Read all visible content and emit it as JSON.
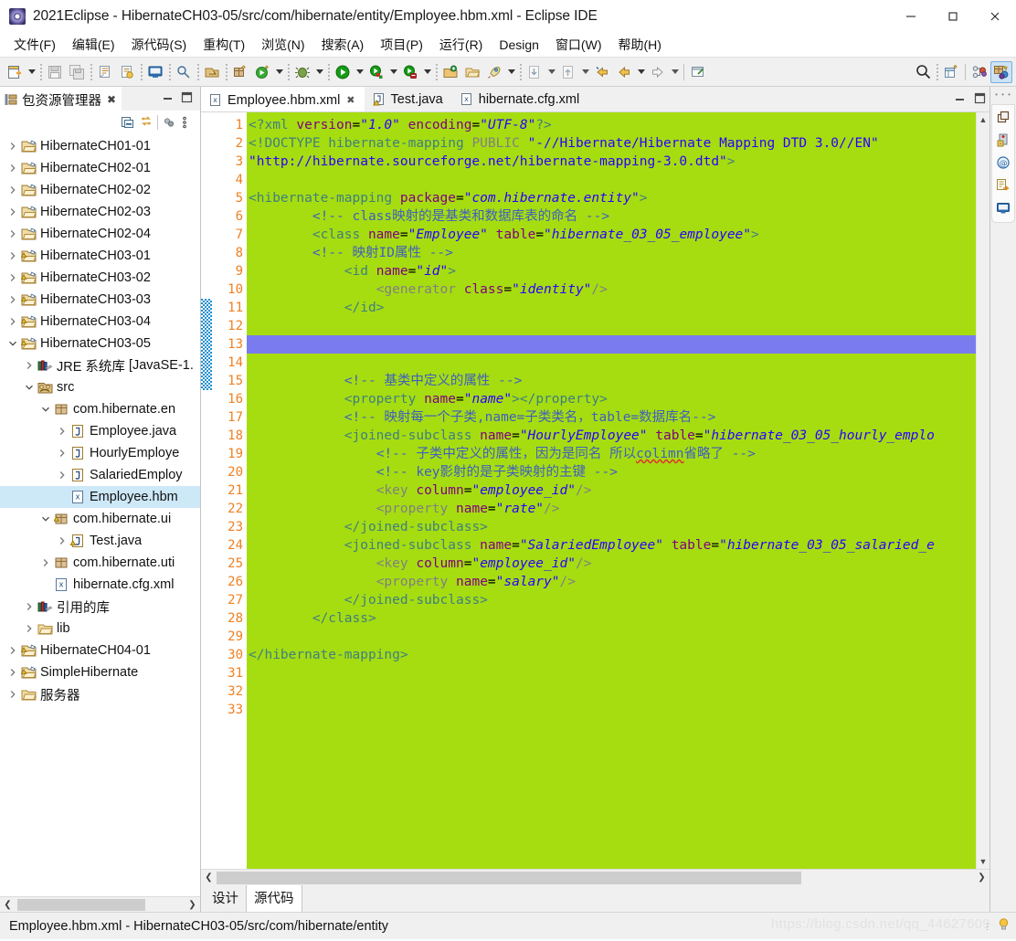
{
  "window": {
    "title": "2021Eclipse - HibernateCH03-05/src/com/hibernate/entity/Employee.hbm.xml - Eclipse IDE",
    "app_icon": "eclipse-icon",
    "minimize_label": "—",
    "maximize_label": "□",
    "close_label": "✕"
  },
  "menubar": {
    "items": [
      {
        "label": "文件(F)"
      },
      {
        "label": "编辑(E)"
      },
      {
        "label": "源代码(S)"
      },
      {
        "label": "重构(T)"
      },
      {
        "label": "浏览(N)"
      },
      {
        "label": "搜索(A)"
      },
      {
        "label": "项目(P)"
      },
      {
        "label": "运行(R)"
      },
      {
        "label": "Design"
      },
      {
        "label": "窗口(W)"
      },
      {
        "label": "帮助(H)"
      }
    ]
  },
  "toolbar": {
    "buttons": [
      "new-icon",
      "save-icon",
      "save-all-icon",
      "print-icon",
      "export-icon",
      "console-icon",
      "search-find-icon",
      "open-type-icon",
      "new-package-icon",
      "run-validate-icon",
      "debug-icon",
      "run-icon",
      "coverage-icon",
      "profile-icon",
      "open-perspective-icon",
      "open-folder-icon",
      "launch-icon",
      "next-annotation-icon",
      "previous-annotation-icon",
      "back-icon",
      "forward-icon",
      "forward-arrow-icon",
      "new-window-icon",
      "search-icon",
      "new-perspective-icon",
      "java-perspective-icon",
      "java-ee-perspective-icon"
    ]
  },
  "explorer": {
    "tab_title": "包资源管理器",
    "tab_icon": "package-explorer-icon",
    "close_icon": "close-icon",
    "view_buttons": [
      "collapse-all-icon",
      "link-with-editor-icon",
      "view-menu-icon",
      "view-menu-dots-icon"
    ],
    "minimize_icon": "minimize-icon",
    "maximize_icon": "maximize-icon",
    "tree": [
      {
        "label": "HibernateCH01-01",
        "icon": "project-icon",
        "indent": 0,
        "twisty": "collapsed",
        "selected": false
      },
      {
        "label": "HibernateCH02-01",
        "icon": "project-icon",
        "indent": 0,
        "twisty": "collapsed",
        "selected": false
      },
      {
        "label": "HibernateCH02-02",
        "icon": "project-icon",
        "indent": 0,
        "twisty": "collapsed",
        "selected": false
      },
      {
        "label": "HibernateCH02-03",
        "icon": "project-icon",
        "indent": 0,
        "twisty": "collapsed",
        "selected": false
      },
      {
        "label": "HibernateCH02-04",
        "icon": "project-icon",
        "indent": 0,
        "twisty": "collapsed",
        "selected": false
      },
      {
        "label": "HibernateCH03-01",
        "icon": "project-warning-icon",
        "indent": 0,
        "twisty": "collapsed",
        "selected": false
      },
      {
        "label": "HibernateCH03-02",
        "icon": "project-warning-icon",
        "indent": 0,
        "twisty": "collapsed",
        "selected": false
      },
      {
        "label": "HibernateCH03-03",
        "icon": "project-warning-icon",
        "indent": 0,
        "twisty": "collapsed",
        "selected": false
      },
      {
        "label": "HibernateCH03-04",
        "icon": "project-warning-icon",
        "indent": 0,
        "twisty": "collapsed",
        "selected": false
      },
      {
        "label": "HibernateCH03-05",
        "icon": "project-warning-icon",
        "indent": 0,
        "twisty": "expanded",
        "selected": false
      },
      {
        "label": "JRE 系统库",
        "suffix": "[JavaSE-1.",
        "icon": "jre-library-icon",
        "indent": 1,
        "twisty": "collapsed",
        "selected": false
      },
      {
        "label": "src",
        "icon": "source-folder-icon",
        "indent": 1,
        "twisty": "expanded",
        "selected": false
      },
      {
        "label": "com.hibernate.en",
        "icon": "package-icon",
        "indent": 2,
        "twisty": "expanded",
        "selected": false
      },
      {
        "label": "Employee.java",
        "icon": "java-file-icon",
        "indent": 3,
        "twisty": "collapsed",
        "selected": false
      },
      {
        "label": "HourlyEmploye",
        "icon": "java-file-icon",
        "indent": 3,
        "twisty": "collapsed",
        "selected": false
      },
      {
        "label": "SalariedEmploy",
        "icon": "java-file-icon",
        "indent": 3,
        "twisty": "collapsed",
        "selected": false
      },
      {
        "label": "Employee.hbm",
        "icon": "xml-file-icon",
        "indent": 3,
        "twisty": "none",
        "selected": true
      },
      {
        "label": "com.hibernate.ui",
        "icon": "package-warning-icon",
        "indent": 2,
        "twisty": "expanded",
        "selected": false
      },
      {
        "label": "Test.java",
        "icon": "java-warning-file-icon",
        "indent": 3,
        "twisty": "collapsed",
        "selected": false
      },
      {
        "label": "com.hibernate.uti",
        "icon": "package-icon",
        "indent": 2,
        "twisty": "collapsed",
        "selected": false
      },
      {
        "label": "hibernate.cfg.xml",
        "icon": "xml-file-icon",
        "indent": 2,
        "twisty": "none",
        "selected": false
      },
      {
        "label": "引用的库",
        "icon": "jre-library-icon",
        "indent": 1,
        "twisty": "collapsed",
        "selected": false
      },
      {
        "label": "lib",
        "icon": "folder-icon",
        "indent": 1,
        "twisty": "collapsed",
        "selected": false
      },
      {
        "label": "HibernateCH04-01",
        "icon": "project-warning-icon",
        "indent": 0,
        "twisty": "collapsed",
        "selected": false
      },
      {
        "label": "SimpleHibernate",
        "icon": "project-warning-icon",
        "indent": 0,
        "twisty": "collapsed",
        "selected": false
      },
      {
        "label": "服务器",
        "icon": "folder-icon",
        "indent": 0,
        "twisty": "collapsed",
        "selected": false
      }
    ],
    "scroll_left_icon": "scroll-left-icon",
    "scroll_right_icon": "scroll-right-icon"
  },
  "editor": {
    "tabs": [
      {
        "label": "Employee.hbm.xml",
        "icon": "xml-file-icon",
        "active": true,
        "closable": true
      },
      {
        "label": "Test.java",
        "icon": "java-warning-file-icon",
        "active": false,
        "closable": false
      },
      {
        "label": "hibernate.cfg.xml",
        "icon": "xml-file-icon",
        "active": false,
        "closable": false
      }
    ],
    "minimize_icon": "minimize-icon",
    "maximize_icon": "maximize-icon",
    "bottom_tabs": [
      {
        "label": "设计",
        "active": false
      },
      {
        "label": "源代码",
        "active": true
      }
    ],
    "background_color": "#a6dd11",
    "current_line": 13,
    "current_line_color": "#7b7bf0",
    "overview_marker_lines": [
      11,
      15
    ],
    "fold_lines": [
      5,
      7,
      9,
      18,
      24
    ],
    "line_count": 33,
    "scroll_up_icon": "scroll-up-icon",
    "scroll_down_icon": "scroll-down-icon",
    "scroll_left_icon": "scroll-left-icon",
    "scroll_right_icon": "scroll-right-icon",
    "lines": [
      {
        "n": 1,
        "html": "<span class=\"pi\">&lt;?xml </span><span class=\"attr\">version</span><span class=\"eq\">=</span><span class=\"val\">\"1.0\"</span><span class=\"eq\"> </span><span class=\"attr\">encoding</span><span class=\"eq\">=</span><span class=\"val\">\"UTF-8\"</span><span class=\"pi\">?&gt;</span>"
      },
      {
        "n": 2,
        "html": "<span class=\"tag\">&lt;!DOCTYPE hibernate-mapping </span><span class=\"dt\">PUBLIC</span><span class=\"tag\"> </span><span class=\"val\" style=\"font-style:normal\">\"-//Hibernate/Hibernate Mapping DTD 3.0//EN\"</span>"
      },
      {
        "n": 3,
        "html": "<span class=\"val\" style=\"font-style:normal\">\"http://hibernate.sourceforge.net/hibernate-mapping-3.0.dtd\"</span><span class=\"tag\">&gt;</span>"
      },
      {
        "n": 4,
        "html": ""
      },
      {
        "n": 5,
        "html": "<span class=\"tag\">&lt;hibernate-mapping </span><span class=\"attr\">package</span><span class=\"eq\">=</span><span class=\"val\">\"com.hibernate.entity\"</span><span class=\"tag\">&gt;</span>"
      },
      {
        "n": 6,
        "html": "        <span class=\"cmt\">&lt;!-- class映射的是基类和数据库表的命名 --&gt;</span>"
      },
      {
        "n": 7,
        "html": "        <span class=\"tag\">&lt;class </span><span class=\"attr\">name</span><span class=\"eq\">=</span><span class=\"val\">\"Employee\"</span><span class=\"eq\"> </span><span class=\"attr\">table</span><span class=\"eq\">=</span><span class=\"val\">\"hibernate_03_05_employee\"</span><span class=\"tag\">&gt;</span>"
      },
      {
        "n": 8,
        "html": "        <span class=\"cmt\">&lt;!-- 映射ID属性 --&gt;</span>"
      },
      {
        "n": 9,
        "html": "            <span class=\"tag\">&lt;id </span><span class=\"attr\">name</span><span class=\"eq\">=</span><span class=\"val\">\"id\"</span><span class=\"tag\">&gt;</span>"
      },
      {
        "n": 10,
        "html": "                <span class=\"dt\">&lt;generator </span><span class=\"attr\">class</span><span class=\"eq\">=</span><span class=\"val\">\"identity\"</span><span class=\"dt\">/&gt;</span>"
      },
      {
        "n": 11,
        "html": "            <span class=\"tag\">&lt;/id&gt;</span>"
      },
      {
        "n": 12,
        "html": ""
      },
      {
        "n": 13,
        "html": ""
      },
      {
        "n": 14,
        "html": ""
      },
      {
        "n": 15,
        "html": "            <span class=\"cmt\">&lt;!-- 基类中定义的属性 --&gt;</span>"
      },
      {
        "n": 16,
        "html": "            <span class=\"tag\">&lt;property </span><span class=\"attr\">name</span><span class=\"eq\">=</span><span class=\"val\">\"name\"</span><span class=\"tag\">&gt;&lt;/property&gt;</span>"
      },
      {
        "n": 17,
        "html": "            <span class=\"cmt\">&lt;!-- 映射每一个子类,name=子类类名，table=数据库名--&gt;</span>"
      },
      {
        "n": 18,
        "html": "            <span class=\"tag\">&lt;joined-subclass </span><span class=\"attr\">name</span><span class=\"eq\">=</span><span class=\"val\">\"HourlyEmployee\"</span><span class=\"eq\"> </span><span class=\"attr\">table</span><span class=\"eq\">=</span><span class=\"val\">\"hibernate_03_05_hourly_emplo</span>"
      },
      {
        "n": 19,
        "html": "                <span class=\"cmt\">&lt;!-- 子类中定义的属性，因为是同名 所以<span class=\"err\">colimn</span>省略了 --&gt;</span>"
      },
      {
        "n": 20,
        "html": "                <span class=\"cmt\">&lt;!-- key影射的是子类映射的主键 --&gt;</span>"
      },
      {
        "n": 21,
        "html": "                <span class=\"dt\">&lt;key </span><span class=\"attr\">column</span><span class=\"eq\">=</span><span class=\"val\">\"employee_id\"</span><span class=\"dt\">/&gt;</span>"
      },
      {
        "n": 22,
        "html": "                <span class=\"dt\">&lt;property </span><span class=\"attr\">name</span><span class=\"eq\">=</span><span class=\"val\">\"rate\"</span><span class=\"dt\">/&gt;</span>"
      },
      {
        "n": 23,
        "html": "            <span class=\"tag\">&lt;/joined-subclass&gt;</span>"
      },
      {
        "n": 24,
        "html": "            <span class=\"tag\">&lt;joined-subclass </span><span class=\"attr\">name</span><span class=\"eq\">=</span><span class=\"val\">\"SalariedEmployee\"</span><span class=\"eq\"> </span><span class=\"attr\">table</span><span class=\"eq\">=</span><span class=\"val\">\"hibernate_03_05_salaried_e</span>"
      },
      {
        "n": 25,
        "html": "                <span class=\"dt\">&lt;key </span><span class=\"attr\">column</span><span class=\"eq\">=</span><span class=\"val\">\"employee_id\"</span><span class=\"dt\">/&gt;</span>"
      },
      {
        "n": 26,
        "html": "                <span class=\"dt\">&lt;property </span><span class=\"attr\">name</span><span class=\"eq\">=</span><span class=\"val\">\"salary\"</span><span class=\"dt\">/&gt;</span>"
      },
      {
        "n": 27,
        "html": "            <span class=\"tag\">&lt;/joined-subclass&gt;</span>"
      },
      {
        "n": 28,
        "html": "        <span class=\"tag\">&lt;/class&gt;</span>"
      },
      {
        "n": 29,
        "html": ""
      },
      {
        "n": 30,
        "html": "<span class=\"tag\">&lt;/hibernate-mapping&gt;</span>"
      },
      {
        "n": 31,
        "html": ""
      },
      {
        "n": 32,
        "html": ""
      },
      {
        "n": 33,
        "html": ""
      }
    ]
  },
  "rightbar": {
    "icons": [
      "restore-view-icon",
      "servers-view-icon",
      "at-sign-icon",
      "snippets-icon",
      "console-view-icon"
    ],
    "dots_icon": "view-dots-icon"
  },
  "statusbar": {
    "text": "Employee.hbm.xml - HibernateCH03-05/src/com/hibernate/entity",
    "watermark": "https://blog.csdn.net/qq_44627609",
    "grip_icon": "resize-grip-icon",
    "tip_icon": "lightbulb-icon",
    "save-state-icon": "save-state-icon"
  }
}
